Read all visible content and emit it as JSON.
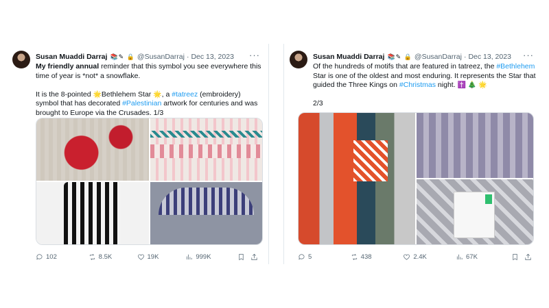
{
  "tweets": [
    {
      "author": {
        "name": "Susan Muaddi Darraj",
        "badges": "📚✎ 🔒",
        "handle": "@SusanDarraj",
        "separator": "·",
        "date": "Dec 13, 2023"
      },
      "more": "···",
      "text": {
        "p1_bold": "My friendly annual",
        "p1_rest": " reminder that this symbol you see everywhere this time of year is *not* a snowflake.",
        "p2_a": "It is the 8-pointed ",
        "p2_emoji1": "🌟",
        "p2_b": "Bethlehem Star ",
        "p2_emoji2": "🌟",
        "p2_c": ", a ",
        "p2_link1": "#tatreez",
        "p2_d": " (embroidery) symbol that has decorated ",
        "p2_link2": "#Palestinian",
        "p2_e": " artwork for centuries and was brought to Europe via the Crusades.  1/3"
      },
      "actions": {
        "replies": "102",
        "reposts": "8.5K",
        "likes": "19K",
        "views": "999K"
      }
    },
    {
      "author": {
        "name": "Susan Muaddi Darraj",
        "badges": "📚✎ 🔒",
        "handle": "@SusanDarraj",
        "separator": "·",
        "date": "Dec 13, 2023"
      },
      "more": "···",
      "text": {
        "p1_a": "Of the hundreds of motifs that are featured in tatreez, the ",
        "p1_link1": "#Bethlehem",
        "p1_b": " Star is one of the oldest and most enduring. It represents the Star that guided the Three Kings on ",
        "p1_link2": "#Christmas",
        "p1_c": " night. ",
        "p1_emojis": "✝️ 🎄 🌟",
        "p2": "2/3"
      },
      "actions": {
        "replies": "5",
        "reposts": "438",
        "likes": "2.4K",
        "views": "67K"
      }
    }
  ],
  "colors": {
    "link": "#1d9bf0",
    "secondary_text": "#536471",
    "primary_text": "#0f1419"
  },
  "icons": [
    "reply-icon",
    "repost-icon",
    "like-icon",
    "views-icon",
    "bookmark-icon",
    "share-icon",
    "more-icon"
  ]
}
